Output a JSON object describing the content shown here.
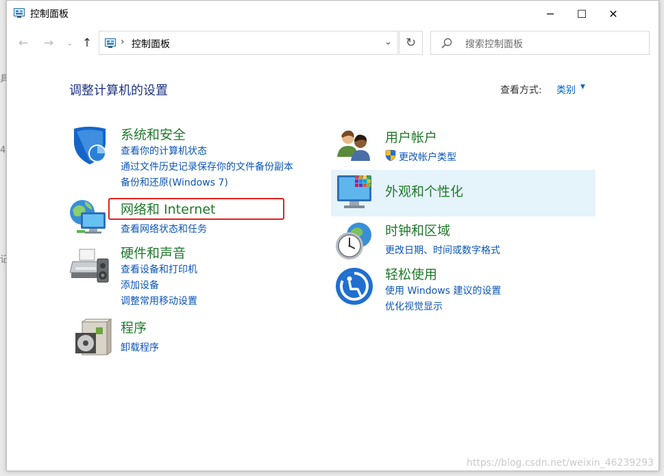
{
  "window": {
    "title": "控制面板",
    "minimize_glyph": "─",
    "maximize_glyph": "☐",
    "close_glyph": "✕"
  },
  "nav": {
    "back_glyph": "←",
    "forward_glyph": "→",
    "history_glyph": "⌄",
    "up_glyph": "↑",
    "address_sep": "›",
    "address_text": "控制面板",
    "address_drop": "⌄",
    "refresh_glyph": "↻",
    "search_placeholder": "搜索控制面板"
  },
  "main": {
    "heading": "调整计算机的设置",
    "view_label": "查看方式:",
    "view_value": "类别",
    "view_caret": "▼"
  },
  "categories": [
    {
      "icon": "shield-icon",
      "title": "系统和安全",
      "links": [
        "查看你的计算机状态",
        "通过文件历史记录保存你的文件备份副本",
        "备份和还原(Windows 7)"
      ]
    },
    {
      "icon": "network-globe-icon",
      "title": "网络和 Internet",
      "links": [
        "查看网络状态和任务"
      ]
    },
    {
      "icon": "printer-speaker-icon",
      "title": "硬件和声音",
      "links": [
        "查看设备和打印机",
        "添加设备",
        "调整常用移动设置"
      ]
    },
    {
      "icon": "programs-disk-icon",
      "title": "程序",
      "links": [
        "卸载程序"
      ]
    },
    {
      "icon": "users-icon",
      "title": "用户帐户",
      "links": [
        "更改帐户类型"
      ]
    },
    {
      "icon": "monitor-palette-icon",
      "title": "外观和个性化",
      "links": []
    },
    {
      "icon": "clock-globe-icon",
      "title": "时钟和区域",
      "links": [
        "更改日期、时间或数字格式"
      ]
    },
    {
      "icon": "ease-of-access-icon",
      "title": "轻松使用",
      "links": [
        "使用 Windows 建议的设置",
        "优化视觉显示"
      ]
    }
  ],
  "watermark": "https://blog.csdn.net/weixin_46239293",
  "colors": {
    "title_green": "#1f7a2b",
    "link_blue": "#0b55b8",
    "heading_blue": "#1e3287",
    "highlight_red": "#e0201e",
    "hover_bg": "#e5f3fb"
  }
}
